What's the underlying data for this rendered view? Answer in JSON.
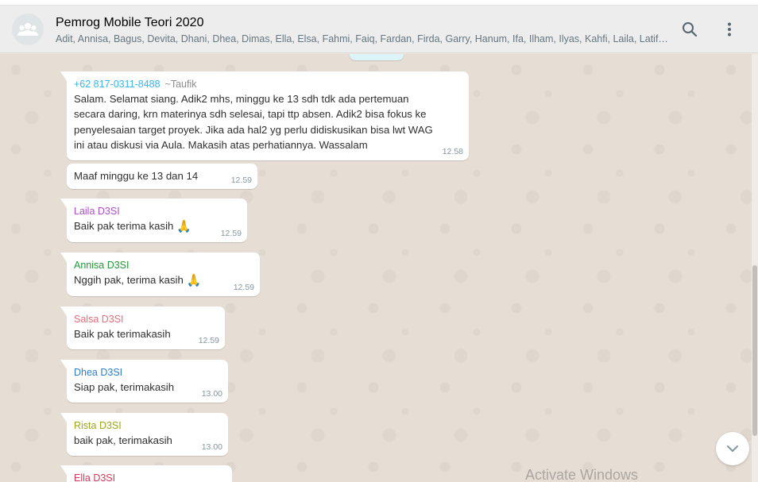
{
  "header": {
    "title": "Pemrog Mobile Teori 2020",
    "members": "Adit, Annisa, Bagus, Devita, Dhani, Dhea, Dimas, Ella, Elsa, Fahmi, Faiq, Fardan, Firda, Garry, Hanum, Ifa, Ilham, Ilyas, Kahfi, Laila, Latif…",
    "avatar_icon": "group-avatar-icon",
    "search_icon": "search-icon",
    "menu_icon": "more-vertical-icon"
  },
  "messages": [
    {
      "sender": "+62 817-0311-8488",
      "sender_color": "#35cd96",
      "sender_alias": "~Taufik",
      "lines": [
        "Salam. Selamat siang. Adik2 mhs, minggu ke 13 sdh tdk ada pertemuan",
        "secara daring, krn materinya sdh selesai, tapi ttp absen. Adik2 bisa fokus ke",
        "penyelesaian target proyek.  Jika ada hal2 yg perlu didiskusikan bisa lwt WAG",
        "ini atau diskusi via Aula. Makasih atas perhatiannya. Wassalam"
      ],
      "time": "12.58"
    },
    {
      "text": "Maaf minggu ke 13 dan 14",
      "time": "12.59"
    },
    {
      "sender": "Laila D3SI",
      "sender_color": "#b54bd1",
      "text": "Baik pak terima kasih",
      "emoji": "🙏",
      "time": "12.59"
    },
    {
      "sender": "Annisa D3SI",
      "sender_color": "#1f9a35",
      "text": "Nggih pak, terima kasih",
      "emoji": "🙏",
      "time": "12.59"
    },
    {
      "sender": "Salsa D3SI",
      "sender_color": "#e46e7c",
      "text": "Baik pak terimakasih",
      "time": "12.59"
    },
    {
      "sender": "Dhea D3SI",
      "sender_color": "#2b7ed3",
      "text": "Siap pak, terimakasih",
      "time": "13.00"
    },
    {
      "sender": "Rista D3SI",
      "sender_color": "#9ea617",
      "text": "baik pak, terimakasih",
      "time": "13.00"
    },
    {
      "sender": "Ella D3SI",
      "sender_color": "#d8395a"
    }
  ],
  "scroll_down_icon": "chevron-down-icon",
  "watermark": "Activate Windows"
}
